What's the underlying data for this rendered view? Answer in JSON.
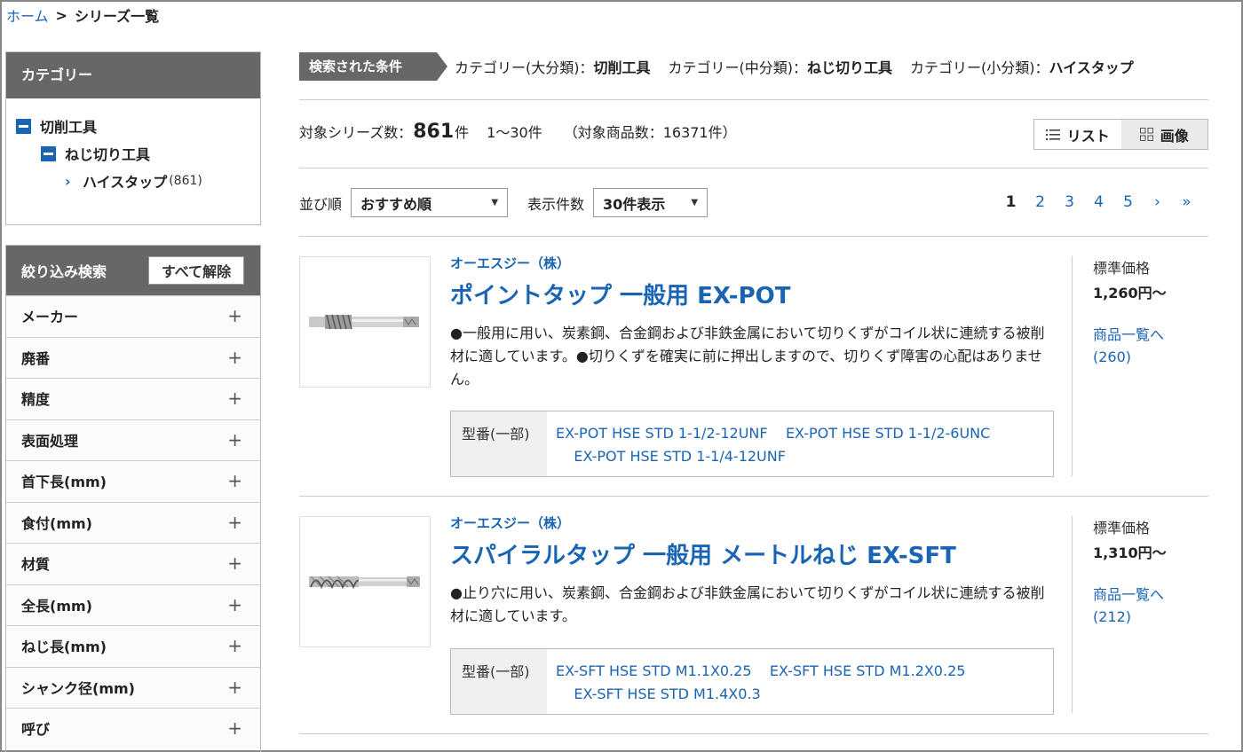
{
  "breadcrumb": {
    "home": "ホーム",
    "separator": ">",
    "current": "シリーズ一覧"
  },
  "sidebar": {
    "category_title": "カテゴリー",
    "tree": [
      {
        "label": "切削工具"
      },
      {
        "label": "ねじ切り工具"
      },
      {
        "label": "ハイスタップ",
        "count": "(861)"
      }
    ],
    "filter_title": "絞り込み検索",
    "clear_all": "すべて解除",
    "filters": [
      "メーカー",
      "廃番",
      "精度",
      "表面処理",
      "首下長(mm)",
      "食付(mm)",
      "材質",
      "全長(mm)",
      "ねじ長(mm)",
      "シャンク径(mm)",
      "呼び"
    ]
  },
  "conditions": {
    "label": "検索された条件",
    "items": [
      {
        "key": "カテゴリー(大分類)：",
        "value": "切削工具"
      },
      {
        "key": "カテゴリー(中分類)：",
        "value": "ねじ切り工具"
      },
      {
        "key": "カテゴリー(小分類)：",
        "value": "ハイスタップ"
      }
    ]
  },
  "results": {
    "series_label": "対象シリーズ数：",
    "series_count": "861",
    "unit": "件",
    "range": "1〜30件",
    "product_count": "（対象商品数：16371件）"
  },
  "view": {
    "list": "リスト",
    "image": "画像"
  },
  "sort": {
    "label": "並び順",
    "selected": "おすすめ順",
    "per_page_label": "表示件数",
    "per_page_selected": "30件表示"
  },
  "pagination": {
    "pages": [
      "1",
      "2",
      "3",
      "4",
      "5"
    ],
    "current": "1",
    "next": "›",
    "last": "»"
  },
  "products": [
    {
      "maker": "オーエスジー（株）",
      "name": "ポイントタップ 一般用 EX-POT",
      "description": "●一般用に用い、炭素鋼、合金鋼および非鉄金属において切りくずがコイル状に連続する被削材に適しています。●切りくずを確実に前に押出しますので、切りくず障害の心配はありません。",
      "model_label": "型番(一部)",
      "models": [
        "EX-POT HSE STD 1-1/2-12UNF",
        "EX-POT HSE STD 1-1/2-6UNC",
        "EX-POT HSE STD 1-1/4-12UNF"
      ],
      "price_label": "標準価格",
      "price": "1,260円〜",
      "list_link": "商品一覧へ",
      "list_count": "(260)"
    },
    {
      "maker": "オーエスジー（株）",
      "name": "スパイラルタップ 一般用 メートルねじ EX-SFT",
      "description": "●止り穴に用い、炭素鋼、合金鋼および非鉄金属において切りくずがコイル状に連続する被削材に適しています。",
      "model_label": "型番(一部)",
      "models": [
        "EX-SFT HSE STD M1.1X0.25",
        "EX-SFT HSE STD M1.2X0.25",
        "EX-SFT HSE STD M1.4X0.3"
      ],
      "price_label": "標準価格",
      "price": "1,310円〜",
      "list_link": "商品一覧へ",
      "list_count": "(212)"
    }
  ]
}
